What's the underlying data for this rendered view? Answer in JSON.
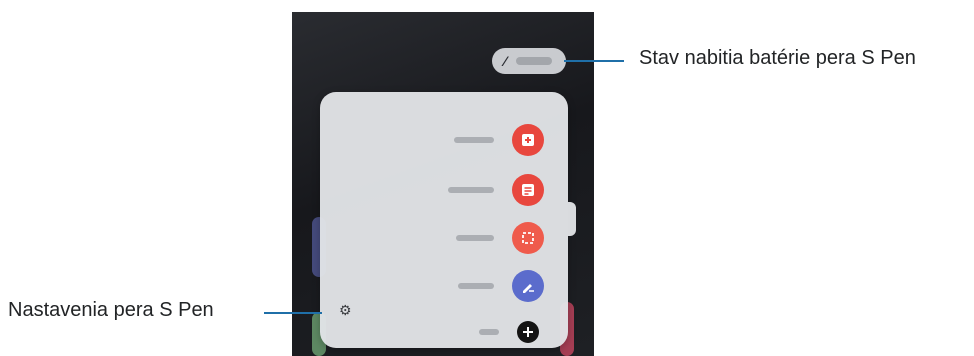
{
  "callouts": {
    "battery_status": "Stav nabitia batérie pera S Pen",
    "pen_settings": "Nastavenia pera S Pen"
  },
  "air_command_menu": {
    "items": [
      {
        "name": "create-note",
        "icon": "note-plus-icon",
        "color": "#e8473e"
      },
      {
        "name": "view-all-notes",
        "icon": "notes-list-icon",
        "color": "#e8473e"
      },
      {
        "name": "smart-select",
        "icon": "smart-select-icon",
        "color": "#ef5b4c"
      },
      {
        "name": "screen-write",
        "icon": "screen-write-icon",
        "color": "#5b6ccc"
      },
      {
        "name": "add-shortcut",
        "icon": "plus-icon",
        "color": "#141414"
      }
    ],
    "settings_icon": "gear-icon"
  },
  "battery_indicator": {
    "icon": "s-pen-icon"
  }
}
